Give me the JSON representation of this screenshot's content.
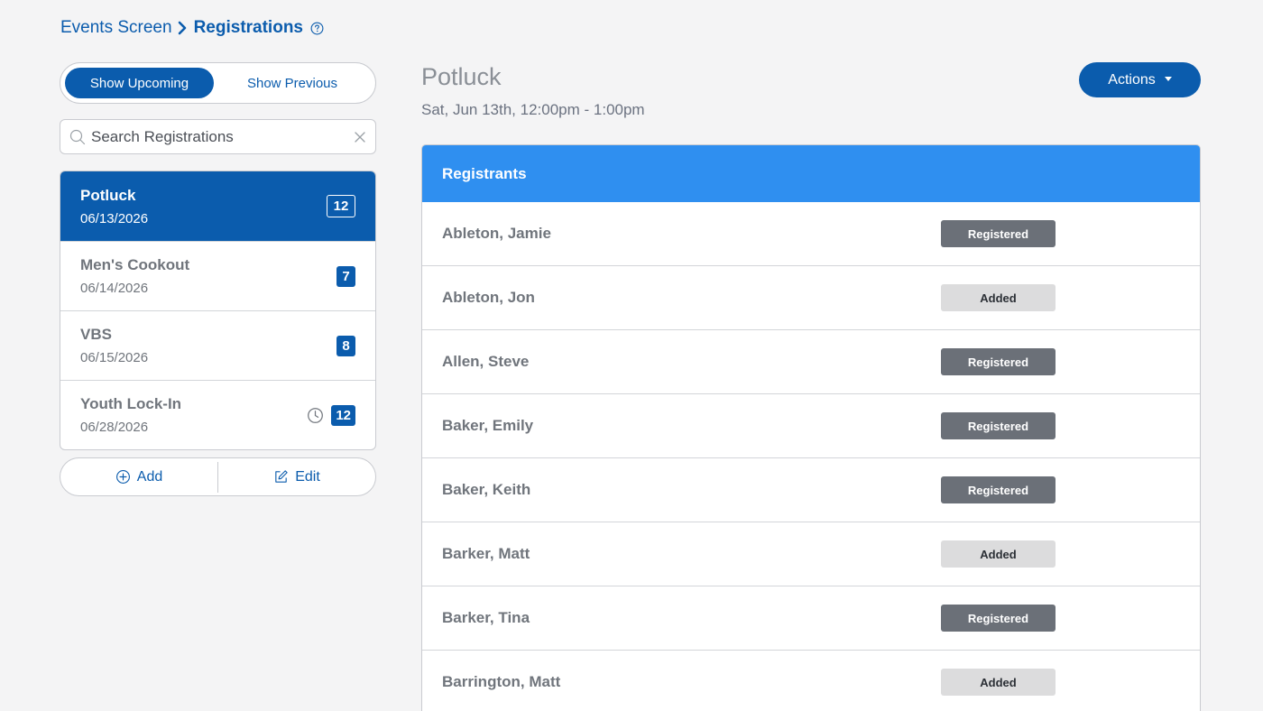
{
  "breadcrumb": {
    "parent": "Events Screen",
    "current": "Registrations"
  },
  "toggle": {
    "upcoming": "Show Upcoming",
    "previous": "Show Previous"
  },
  "search": {
    "placeholder": "Search Registrations"
  },
  "events": [
    {
      "name": "Potluck",
      "date": "06/13/2026",
      "count": "12"
    },
    {
      "name": "Men's Cookout",
      "date": "06/14/2026",
      "count": "7"
    },
    {
      "name": "VBS",
      "date": "06/15/2026",
      "count": "8"
    },
    {
      "name": "Youth Lock-In",
      "date": "06/28/2026",
      "count": "12"
    }
  ],
  "buttons": {
    "add": "Add",
    "edit": "Edit",
    "actions": "Actions"
  },
  "detail": {
    "title": "Potluck",
    "when": "Sat, Jun 13th, 12:00pm - 1:00pm",
    "panel_title": "Registrants"
  },
  "registrants": [
    {
      "name": "Ableton, Jamie",
      "status": "Registered"
    },
    {
      "name": "Ableton, Jon",
      "status": "Added"
    },
    {
      "name": "Allen, Steve",
      "status": "Registered"
    },
    {
      "name": "Baker, Emily",
      "status": "Registered"
    },
    {
      "name": "Baker, Keith",
      "status": "Registered"
    },
    {
      "name": "Barker, Matt",
      "status": "Added"
    },
    {
      "name": "Barker, Tina",
      "status": "Registered"
    },
    {
      "name": "Barrington, Matt",
      "status": "Added"
    }
  ],
  "colors": {
    "primary": "#0b5cad",
    "panel_header": "#2f8ff0",
    "registered": "#6b7078",
    "added": "#dcdcdd"
  }
}
